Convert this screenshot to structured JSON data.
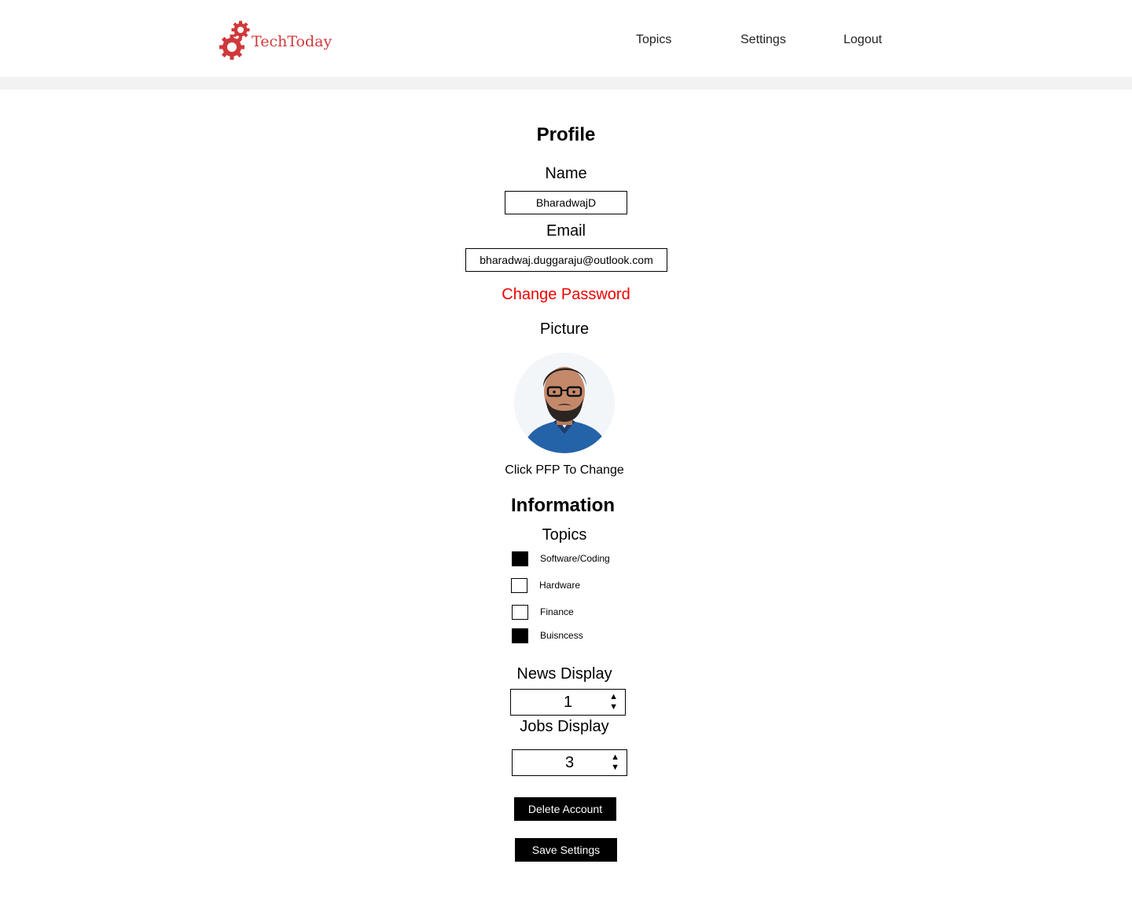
{
  "header": {
    "brand": "TechToday",
    "brand_color": "#d0393b",
    "nav": [
      {
        "label": "Topics"
      },
      {
        "label": "Settings"
      },
      {
        "label": "Logout"
      }
    ]
  },
  "profile": {
    "heading": "Profile",
    "name_label": "Name",
    "name_value": "BharadwajD",
    "email_label": "Email",
    "email_value": "bharadwaj.duggaraju@outlook.com",
    "change_password": "Change Password",
    "change_password_color": "#ee0000",
    "picture_label": "Picture",
    "picture_hint": "Click PFP To Change"
  },
  "information": {
    "heading": "Information",
    "topics_label": "Topics",
    "topics": [
      {
        "label": "Software/Coding",
        "checked": true
      },
      {
        "label": "Hardware",
        "checked": false
      },
      {
        "label": "Finance",
        "checked": false
      },
      {
        "label": "Buisncess",
        "checked": true
      }
    ],
    "news_display_label": "News Display",
    "news_display_value": "1",
    "jobs_display_label": "Jobs Display",
    "jobs_display_value": "3",
    "spinner_up": "▲",
    "spinner_down": "▼"
  },
  "actions": {
    "delete_account": "Delete Account",
    "save_settings": "Save Settings"
  }
}
